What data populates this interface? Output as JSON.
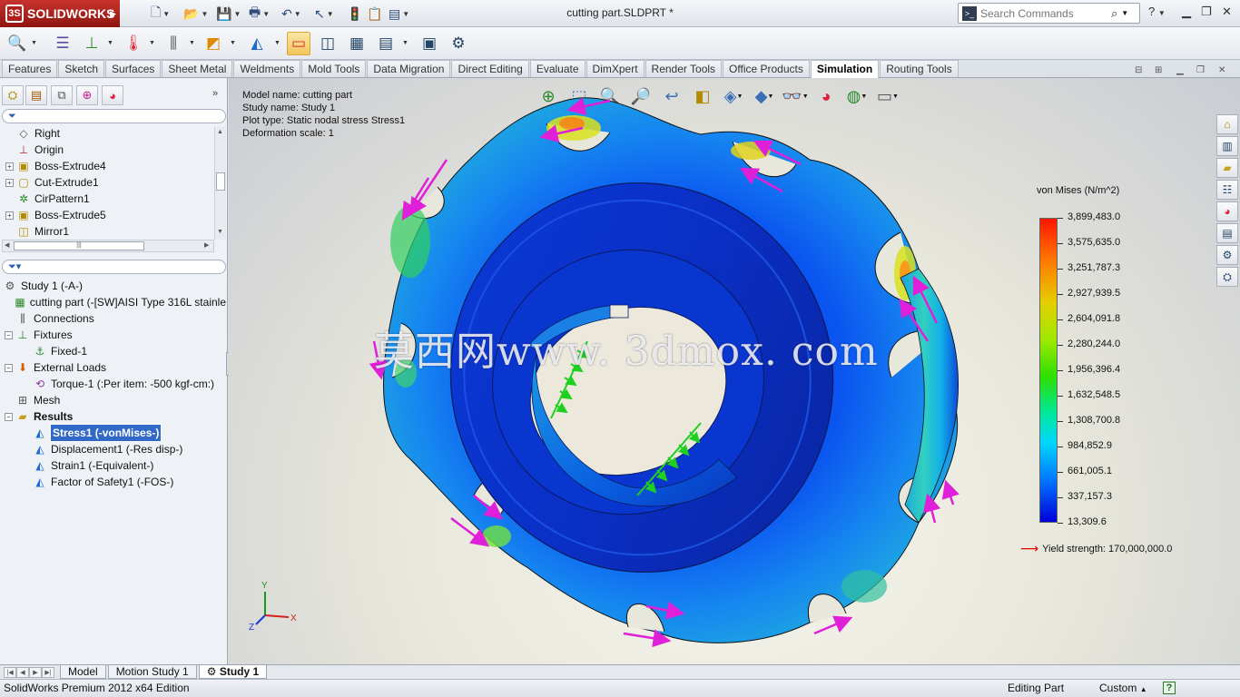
{
  "app": {
    "brand": "SOLIDWORKS",
    "doc_title": "cutting part.SLDPRT *"
  },
  "search": {
    "placeholder": "Search Commands"
  },
  "tabs": [
    {
      "label": "Features"
    },
    {
      "label": "Sketch"
    },
    {
      "label": "Surfaces"
    },
    {
      "label": "Sheet Metal"
    },
    {
      "label": "Weldments"
    },
    {
      "label": "Mold Tools"
    },
    {
      "label": "Data Migration"
    },
    {
      "label": "Direct Editing"
    },
    {
      "label": "Evaluate"
    },
    {
      "label": "DimXpert"
    },
    {
      "label": "Render Tools"
    },
    {
      "label": "Office Products"
    },
    {
      "label": "Simulation",
      "active": true
    },
    {
      "label": "Routing Tools"
    }
  ],
  "feature_tree": [
    {
      "label": "Right",
      "icon": "plane-icon"
    },
    {
      "label": "Origin",
      "icon": "origin-icon"
    },
    {
      "label": "Boss-Extrude4",
      "icon": "extrude-icon",
      "expandable": true
    },
    {
      "label": "Cut-Extrude1",
      "icon": "cut-extrude-icon",
      "expandable": true
    },
    {
      "label": "CirPattern1",
      "icon": "circular-pattern-icon"
    },
    {
      "label": "Boss-Extrude5",
      "icon": "extrude-icon",
      "expandable": true
    },
    {
      "label": "Mirror1",
      "icon": "mirror-icon"
    }
  ],
  "study_tree": {
    "root": "Study 1 (-A-)",
    "items": [
      {
        "label": "cutting part (-[SW]AISI Type 316L stainle",
        "indent": 1,
        "icon": "part-material-icon"
      },
      {
        "label": "Connections",
        "indent": 1,
        "icon": "connections-icon"
      },
      {
        "label": "Fixtures",
        "indent": 1,
        "icon": "fixtures-icon",
        "expandable": true
      },
      {
        "label": "Fixed-1",
        "indent": 2,
        "icon": "fixed-icon"
      },
      {
        "label": "External Loads",
        "indent": 1,
        "icon": "external-loads-icon",
        "expandable": true
      },
      {
        "label": "Torque-1 (:Per item: -500 kgf-cm:)",
        "indent": 2,
        "icon": "torque-icon"
      },
      {
        "label": "Mesh",
        "indent": 1,
        "icon": "mesh-icon"
      },
      {
        "label": "Results",
        "indent": 1,
        "icon": "results-folder-icon",
        "expandable": true,
        "bold": true
      },
      {
        "label": "Stress1 (-vonMises-)",
        "indent": 2,
        "icon": "plot-icon",
        "selected": true
      },
      {
        "label": "Displacement1 (-Res disp-)",
        "indent": 2,
        "icon": "plot-icon"
      },
      {
        "label": "Strain1 (-Equivalent-)",
        "indent": 2,
        "icon": "plot-icon"
      },
      {
        "label": "Factor of Safety1 (-FOS-)",
        "indent": 2,
        "icon": "plot-icon"
      }
    ]
  },
  "model_info": {
    "line1": "Model name: cutting part",
    "line2": "Study name: Study 1",
    "line3": "Plot type: Static nodal stress Stress1",
    "line4": "Deformation scale: 1"
  },
  "legend": {
    "title": "von Mises (N/m^2)",
    "ticks": [
      "3,899,483.0",
      "3,575,635.0",
      "3,251,787.3",
      "2,927,939.5",
      "2,604,091.8",
      "2,280,244.0",
      "1,956,396.4",
      "1,632,548.5",
      "1,308,700.8",
      "984,852.9",
      "661,005.1",
      "337,157.3",
      "13,309.6"
    ],
    "yield_label": "Yield strength: 170,000,000.0",
    "yield_color": "#e00000"
  },
  "watermark": "莫西网www. 3dmox. com",
  "triad": {
    "x": "X",
    "y": "Y",
    "z": "Z"
  },
  "sheet_tabs": [
    {
      "label": "Model"
    },
    {
      "label": "Motion Study 1"
    },
    {
      "label": "Study 1",
      "active": true
    }
  ],
  "status": {
    "left": "SolidWorks Premium 2012 x64 Edition",
    "editing": "Editing Part",
    "units": "Custom",
    "help": "?"
  }
}
